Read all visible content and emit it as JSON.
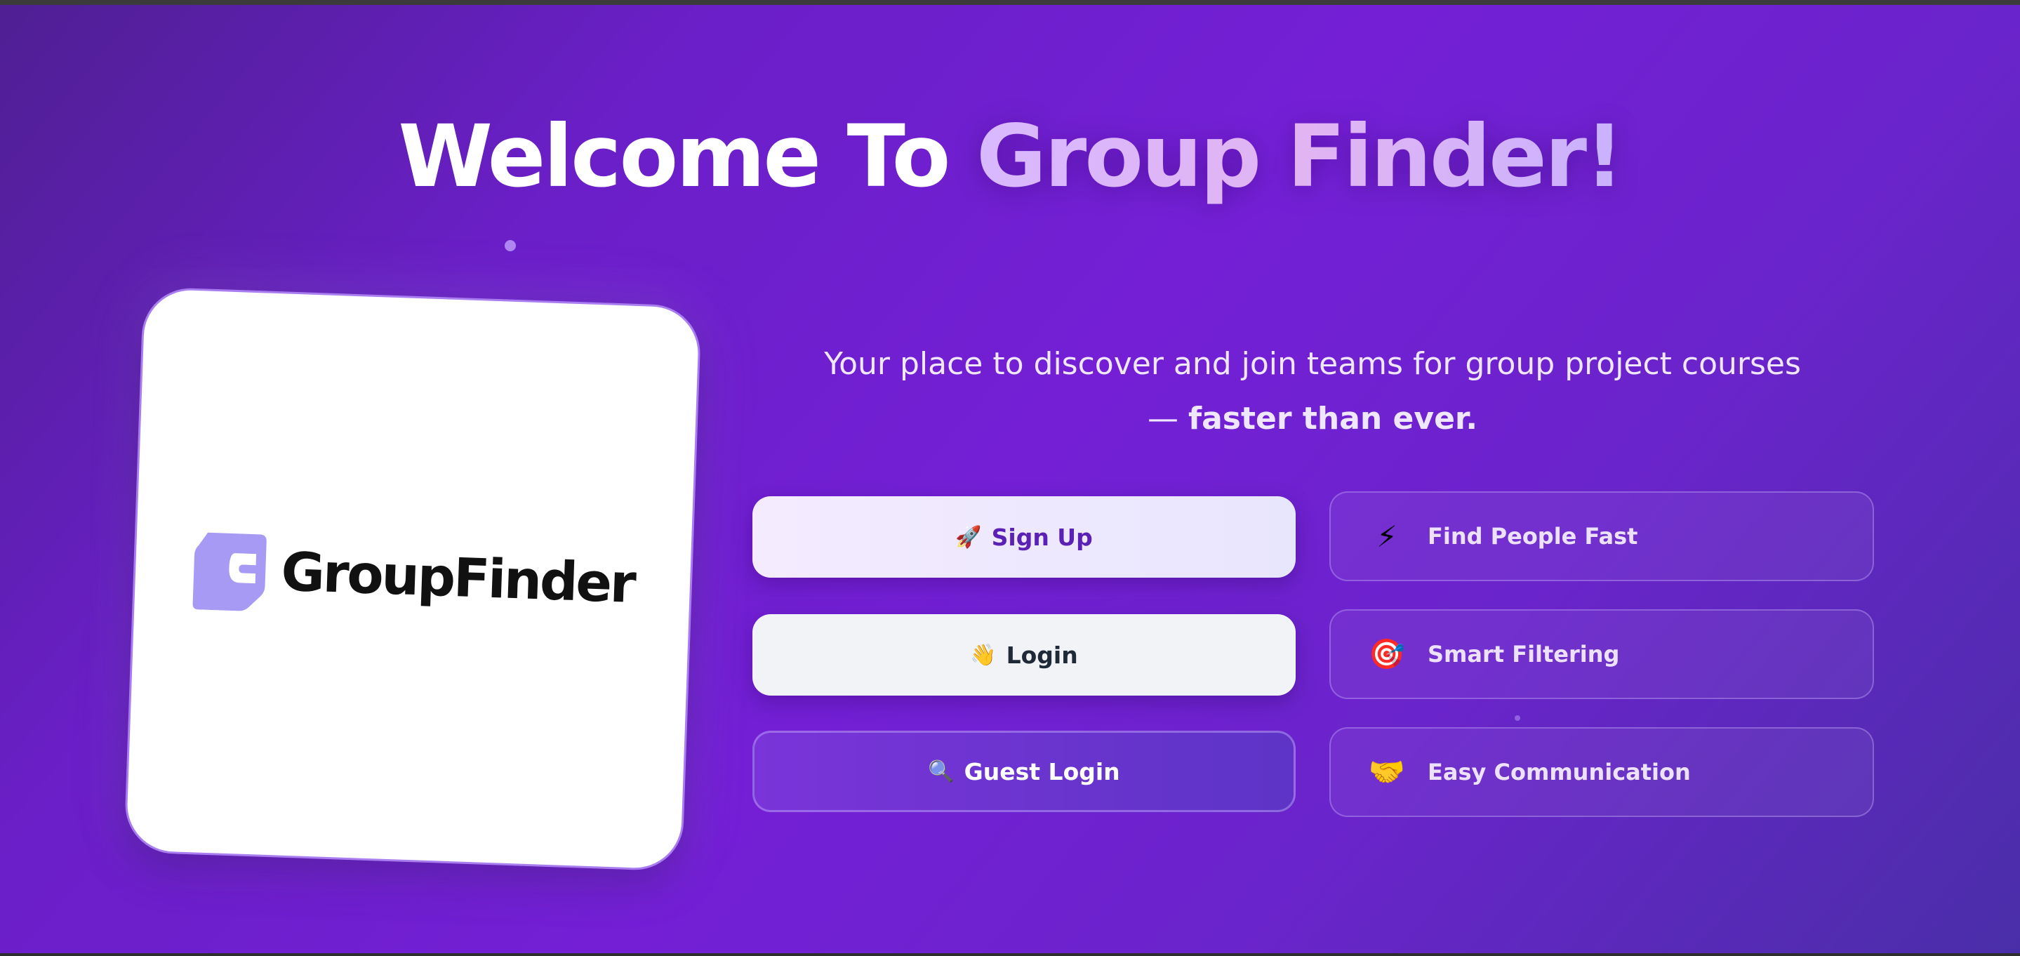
{
  "title": {
    "prefix": "Welcome To",
    "highlight": "Group Finder!"
  },
  "logo": {
    "text": "GroupFinder",
    "mark_color": "#a79af5"
  },
  "tagline": {
    "line1": "Your place to discover and join teams for group project courses",
    "line2_prefix": "— ",
    "line2_strong": "faster than ever."
  },
  "buttons": {
    "signup": {
      "icon": "🚀",
      "label": "Sign Up"
    },
    "login": {
      "icon": "👋",
      "label": "Login"
    },
    "guest": {
      "icon": "🔍",
      "label": "Guest Login"
    }
  },
  "features": [
    {
      "icon": "⚡",
      "icon_name": "lightning-icon",
      "label": "Find People Fast"
    },
    {
      "icon": "🎯",
      "icon_name": "target-icon",
      "label": "Smart Filtering"
    },
    {
      "icon": "🤝",
      "icon_name": "handshake-icon",
      "label": "Easy Communication"
    }
  ],
  "colors": {
    "accent_purple": "#741fd6",
    "signup_text": "#5b21b6"
  }
}
